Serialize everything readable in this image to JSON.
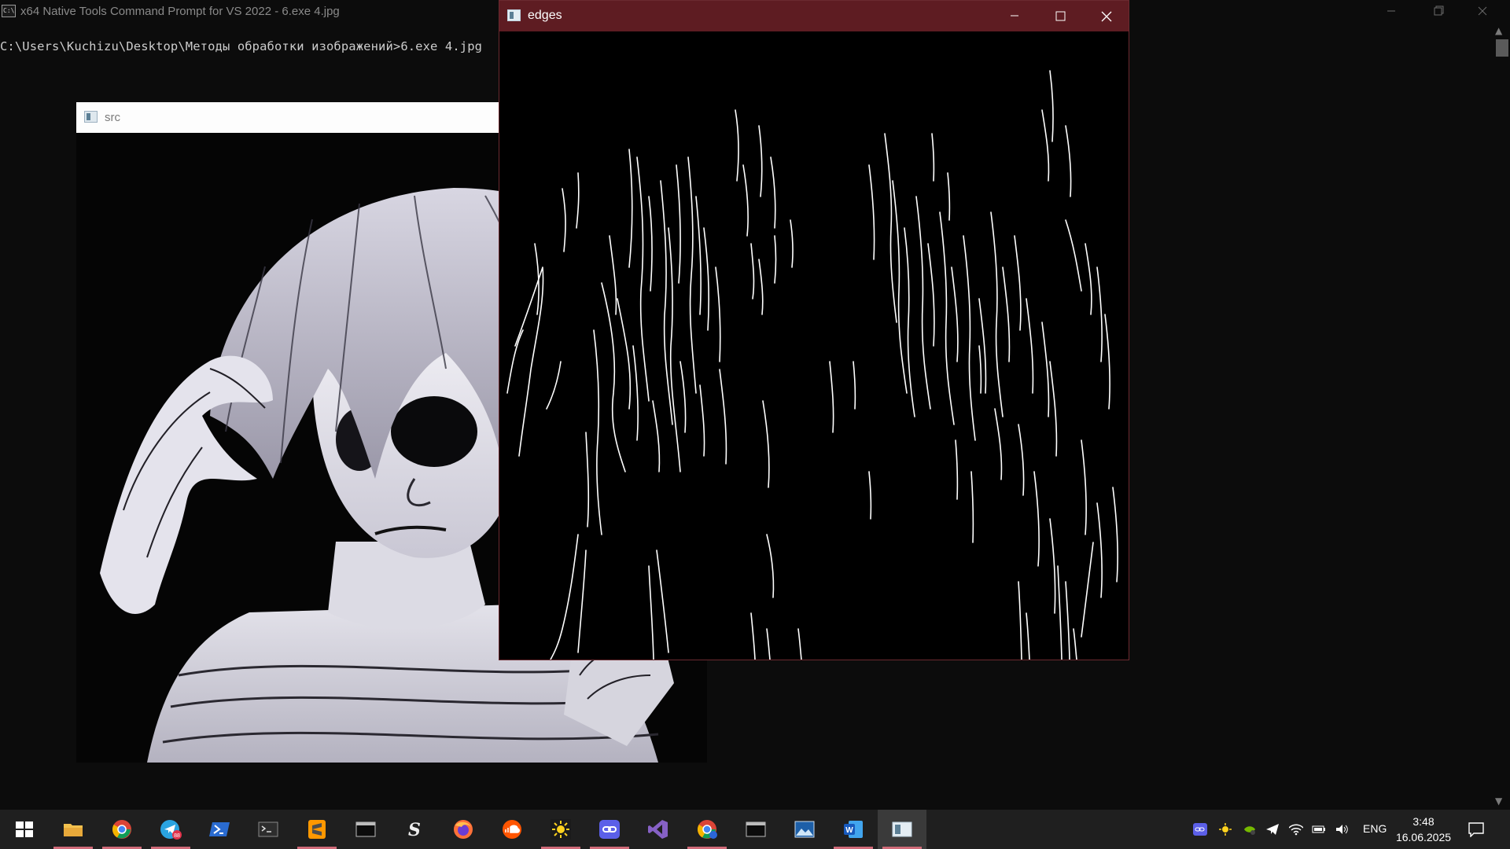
{
  "console": {
    "title": "x64 Native Tools Command Prompt for VS 2022 - 6.exe  4.jpg",
    "command_line": "C:\\Users\\Kuchizu\\Desktop\\Методы обработки изображений>6.exe 4.jpg"
  },
  "src_window": {
    "title": "src",
    "image_alt": "grayscale manga drawing of a person with light hair and a hand on their shoulder"
  },
  "edges_window": {
    "title": "edges"
  },
  "taskbar": {
    "items": [
      {
        "name": "start-button",
        "icon": "windows-icon"
      },
      {
        "name": "file-explorer",
        "icon": "folder-icon"
      },
      {
        "name": "chrome",
        "icon": "chrome-icon"
      },
      {
        "name": "telegram",
        "icon": "telegram-icon",
        "badge": "88"
      },
      {
        "name": "powershell",
        "icon": "powershell-icon"
      },
      {
        "name": "terminal",
        "icon": "terminal-icon"
      },
      {
        "name": "sublime-text",
        "icon": "sublime-icon"
      },
      {
        "name": "console-app",
        "icon": "console-icon"
      },
      {
        "name": "app-s",
        "icon": "s-icon"
      },
      {
        "name": "firefox",
        "icon": "firefox-icon"
      },
      {
        "name": "soundcloud",
        "icon": "soundcloud-icon"
      },
      {
        "name": "sun-app",
        "icon": "sun-icon"
      },
      {
        "name": "link-app",
        "icon": "link-icon"
      },
      {
        "name": "visual-studio",
        "icon": "visual-studio-icon"
      },
      {
        "name": "chrome-canary",
        "icon": "chrome-canary-icon"
      },
      {
        "name": "console-app-2",
        "icon": "console-icon"
      },
      {
        "name": "photos",
        "icon": "photos-icon"
      },
      {
        "name": "word",
        "icon": "word-icon"
      },
      {
        "name": "opencv-window",
        "icon": "window-icon"
      }
    ],
    "tray": {
      "language": "ENG",
      "time": "3:48",
      "date": "16.06.2025"
    }
  },
  "colors": {
    "console_bg": "#0c0c0c",
    "edges_titlebar": "#5e1c22",
    "taskbar": "#1f1f1f",
    "accent_underline": "#cf6a78"
  }
}
